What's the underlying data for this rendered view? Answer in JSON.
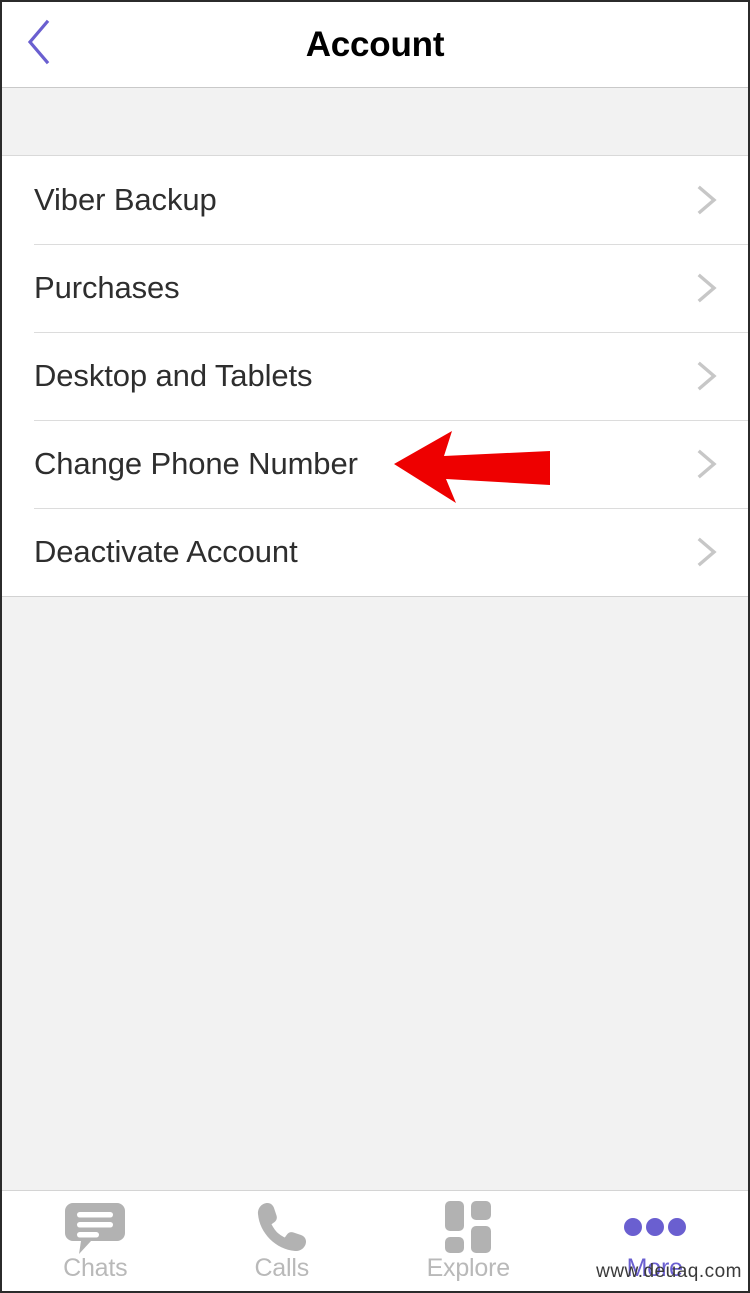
{
  "header": {
    "title": "Account",
    "back_icon": "chevron-left-icon",
    "back_color": "#6a5fd0"
  },
  "settings": {
    "rows": [
      {
        "label": "Viber Backup",
        "chevron": "chevron-right-icon"
      },
      {
        "label": "Purchases",
        "chevron": "chevron-right-icon"
      },
      {
        "label": "Desktop and Tablets",
        "chevron": "chevron-right-icon"
      },
      {
        "label": "Change Phone Number",
        "chevron": "chevron-right-icon"
      },
      {
        "label": "Deactivate Account",
        "chevron": "chevron-right-icon"
      }
    ]
  },
  "annotation": {
    "type": "arrow-left",
    "color": "#ee0000",
    "points_at": "Change Phone Number"
  },
  "tabbar": {
    "items": [
      {
        "label": "Chats",
        "icon": "chat-bubble-icon",
        "active": false
      },
      {
        "label": "Calls",
        "icon": "phone-handset-icon",
        "active": false
      },
      {
        "label": "Explore",
        "icon": "grid-tiles-icon",
        "active": false
      },
      {
        "label": "More",
        "icon": "three-dots-icon",
        "active": true
      }
    ],
    "inactive_color": "#b9b9b9",
    "active_color": "#6a5fd0"
  },
  "watermark": {
    "text": "www.deuaq.com"
  }
}
